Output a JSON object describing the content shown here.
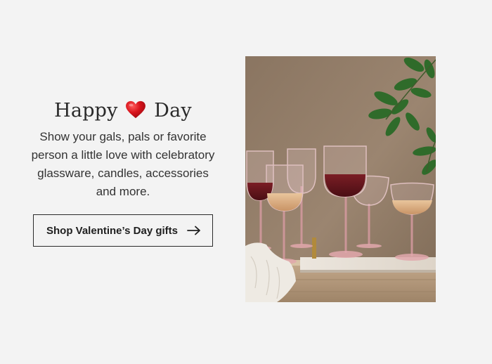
{
  "promo": {
    "headline_before": "Happy",
    "headline_after": "Day",
    "heart_icon": "red-heart-icon",
    "body": "Show your gals, pals or favorite person a little love with celebratory glassware, candles, accessories and more.",
    "cta_label": "Shop Valentine’s Day gifts",
    "cta_icon": "arrow-right-icon"
  },
  "colors": {
    "background": "#f3f3f3",
    "heart": "#d0151d",
    "text": "#2a2a2a"
  }
}
